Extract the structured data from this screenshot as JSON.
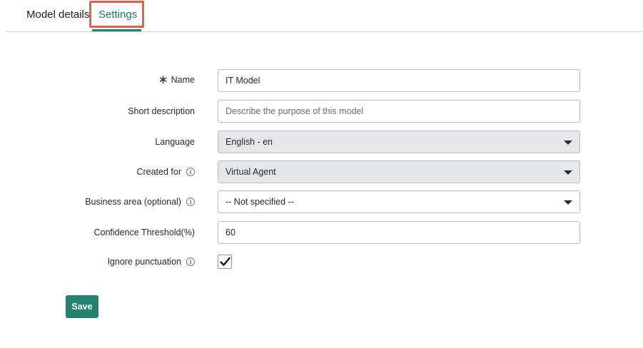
{
  "tabs": {
    "details_label": "Model details",
    "settings_label": "Settings"
  },
  "form": {
    "name": {
      "label": "Name",
      "value": "IT Model"
    },
    "short_description": {
      "label": "Short description",
      "placeholder": "Describe the purpose of this model"
    },
    "language": {
      "label": "Language",
      "value": "English - en"
    },
    "created_for": {
      "label": "Created for",
      "value": "Virtual Agent"
    },
    "business_area": {
      "label": "Business area (optional)",
      "value": "-- Not specified --"
    },
    "confidence_threshold": {
      "label": "Confidence Threshold(%)",
      "value": "60"
    },
    "ignore_punctuation": {
      "label": "Ignore punctuation",
      "checked": true
    }
  },
  "actions": {
    "save_label": "Save"
  },
  "colors": {
    "accent": "#24806f",
    "highlight_border": "#e85d4f"
  }
}
